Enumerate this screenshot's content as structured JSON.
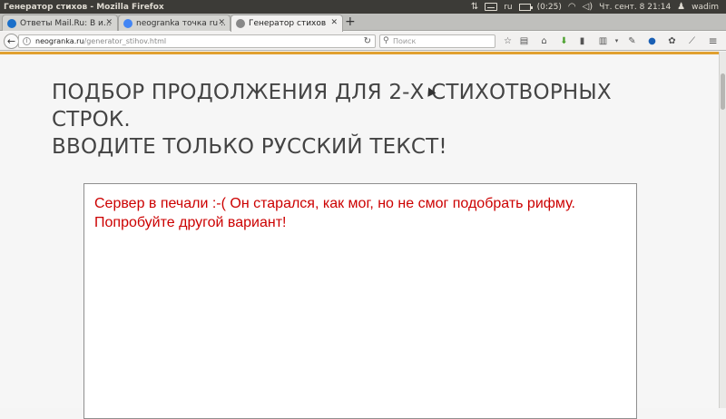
{
  "panel": {
    "window_title": "Генератор стихов - Mozilla Firefox",
    "keyboard_layout": "ru",
    "battery": "(0:25)",
    "clock": "Чт. сент.  8 21:14",
    "user": "wadim"
  },
  "tabs": [
    {
      "label": "Ответы Mail.Ru: В и...",
      "favicon_color": "#1a6fc9"
    },
    {
      "label": "neogranka точка ru ...",
      "favicon_color": "#4285f4"
    },
    {
      "label": "Генератор стихов",
      "favicon_color": "#888888"
    }
  ],
  "navbar": {
    "url_domain": "neogranka.ru",
    "url_path": "/generator_stihov.html",
    "search_placeholder": "Поиск"
  },
  "page": {
    "heading_line1": "ПОДБОР ПРОДОЛЖЕНИЯ ДЛЯ 2-Х СТИХОТВОРНЫХ СТРОК.",
    "heading_line2": "ВВОДИТЕ ТОЛЬКО РУССКИЙ ТЕКСТ!",
    "result_line1": "Сервер в печали :-( Он старался, как мог, но не смог подобрать рифму.",
    "result_line2": "Попробуйте другой вариант!"
  },
  "colors": {
    "accent_line": "#e0a030",
    "error_text": "#cc0000"
  }
}
